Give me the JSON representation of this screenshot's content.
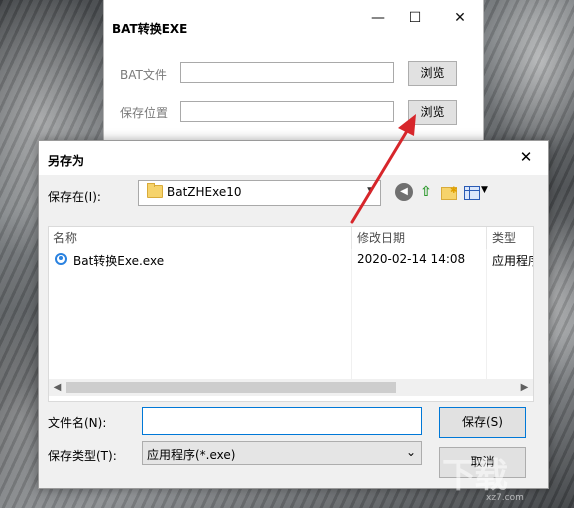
{
  "back_window": {
    "title": "BAT转换EXE",
    "bat_file_label": "BAT文件",
    "save_location_label": "保存位置",
    "browse_label_1": "浏览",
    "browse_label_2": "浏览",
    "minimize_glyph": "—",
    "maximize_glyph": "☐",
    "close_glyph": "✕"
  },
  "dialog": {
    "title": "另存为",
    "close_glyph": "✕",
    "save_in_label": "保存在(I):",
    "folder_name": "BatZHExe10",
    "columns": [
      "名称",
      "修改日期",
      "类型"
    ],
    "files": [
      {
        "name": "Bat转换Exe.exe",
        "modified": "2020-02-14 14:08",
        "type": "应用程序"
      }
    ],
    "filename_label": "文件名(N):",
    "filename_value": "",
    "filetype_label": "保存类型(T):",
    "filetype_value": "应用程序(*.exe)",
    "save_button": "保存(S)",
    "cancel_button": "取消"
  },
  "watermark": {
    "text": "下载",
    "url": "xz7.com"
  },
  "colors": {
    "accent": "#0078d7",
    "arrow": "#d7262b",
    "folder": "#f6d36b"
  }
}
